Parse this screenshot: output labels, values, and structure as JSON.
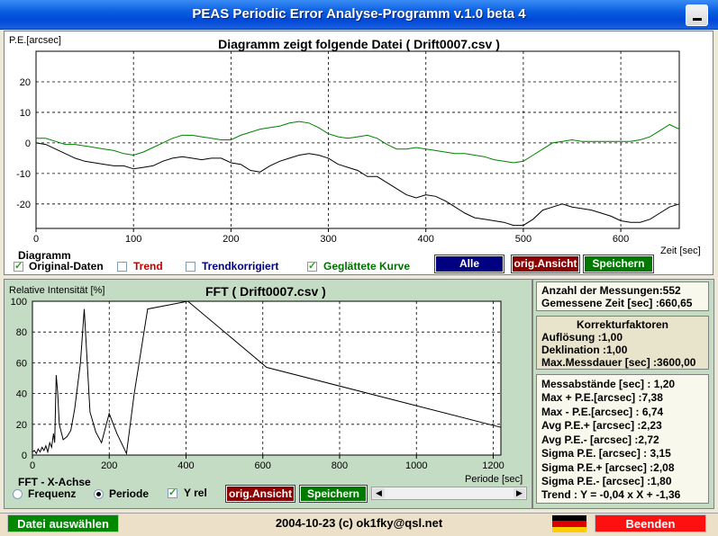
{
  "window": {
    "title": "PEAS Periodic Error Analyse-Programm v.1.0 beta 4"
  },
  "upper_chart": {
    "title": "Diagramm zeigt folgende Datei ( Drift0007.csv )",
    "ylabel": "P.E.[arcsec]",
    "xlabel": "Zeit [sec]",
    "y_ticks": [
      "20",
      "10",
      "0",
      "-10",
      "-20"
    ],
    "x_ticks": [
      "0",
      "100",
      "200",
      "300",
      "400",
      "500",
      "600"
    ]
  },
  "diagram_options": {
    "group_label": "Diagramm",
    "original": {
      "label": "Original-Daten",
      "checked": true
    },
    "trend": {
      "label": "Trend",
      "checked": false,
      "color": "#c00000"
    },
    "trendkorrigiert": {
      "label": "Trendkorrigiert",
      "checked": false,
      "color": "#000080"
    },
    "geglaettet": {
      "label": "Geglättete Kurve",
      "checked": true,
      "color": "#007000"
    },
    "alle_label": "Alle",
    "orig_label": "orig.Ansicht",
    "save_label": "Speichern"
  },
  "fft_chart": {
    "title": "FFT ( Drift0007.csv )",
    "ylabel": "Relative Intensität [%]",
    "xlabel": "Periode [sec]",
    "y_ticks": [
      "100",
      "80",
      "60",
      "40",
      "20",
      "0"
    ],
    "x_ticks": [
      "0",
      "200",
      "400",
      "600",
      "800",
      "1000",
      "1200"
    ]
  },
  "fft_controls": {
    "axis_label": "FFT - X-Achse",
    "frequenz": "Frequenz",
    "periode": "Periode",
    "selected": "Periode",
    "yrel_label": "Y rel",
    "yrel_checked": true,
    "orig_label": "orig.Ansicht",
    "save_label": "Speichern"
  },
  "measurement": {
    "anzahl": "Anzahl der Messungen:552",
    "zeit": "Gemessene Zeit [sec] :660,65"
  },
  "korrektur": {
    "heading": "Korrekturfaktoren",
    "aufloesung": "Auflösung :1,00",
    "deklination": "Deklination :1,00",
    "messdauer": "Max.Messdauer [sec] :3600,00"
  },
  "stats": [
    "Messabstände [sec] : 1,20",
    "Max + P.E.[arcsec] :7,38",
    "Max - P.E.[arcsec] : 6,74",
    "Avg P.E.+ [arcsec] :2,23",
    "Avg P.E.- [arcsec] :2,72",
    "Sigma P.E. [arcsec] : 3,15",
    "Sigma P.E.+ [arcsec] :2,08",
    "Sigma P.E.- [arcsec] :1,80",
    "Trend : Y = -0,04 x X + -1,36"
  ],
  "statusbar": {
    "file_button": "Datei auswählen",
    "info": "2004-10-23 (c) ok1fky@qsl.net",
    "exit_button": "Beenden",
    "flag_icon": "german-flag-icon"
  },
  "chart_data": [
    {
      "type": "line",
      "title": "Diagramm zeigt folgende Datei ( Drift0007.csv )",
      "xlabel": "Zeit [sec]",
      "ylabel": "P.E.[arcsec]",
      "xlim": [
        0,
        660
      ],
      "ylim": [
        -28,
        30
      ],
      "grid": true,
      "series": [
        {
          "name": "Original-Daten",
          "color": "#000000",
          "x": [
            0,
            10,
            20,
            30,
            40,
            50,
            60,
            70,
            80,
            90,
            100,
            110,
            120,
            130,
            140,
            150,
            160,
            170,
            180,
            190,
            200,
            210,
            220,
            230,
            240,
            250,
            260,
            270,
            280,
            290,
            300,
            310,
            320,
            330,
            340,
            350,
            360,
            370,
            380,
            390,
            400,
            410,
            420,
            430,
            440,
            450,
            460,
            470,
            480,
            490,
            500,
            510,
            520,
            530,
            540,
            550,
            560,
            570,
            580,
            590,
            600,
            610,
            620,
            630,
            640,
            650,
            660
          ],
          "values": [
            0,
            -0.5,
            -2,
            -3.5,
            -5,
            -6,
            -6.5,
            -7,
            -7.5,
            -7.5,
            -8.5,
            -8,
            -7.5,
            -6,
            -5,
            -4.5,
            -5,
            -5.5,
            -5,
            -5,
            -6.5,
            -7,
            -9,
            -9.5,
            -7.5,
            -6,
            -5,
            -4,
            -3.5,
            -4,
            -5,
            -7,
            -8,
            -9,
            -11,
            -11,
            -13,
            -15,
            -17,
            -18,
            -17,
            -17.5,
            -19,
            -21,
            -23,
            -24.5,
            -25,
            -25.5,
            -26,
            -27,
            -27,
            -25,
            -22,
            -21,
            -20,
            -21,
            -21.5,
            -22,
            -23,
            -24,
            -25.5,
            -26,
            -26,
            -25,
            -23,
            -21,
            -20
          ]
        },
        {
          "name": "Geglättete Kurve",
          "color": "#008000",
          "x": [
            0,
            10,
            20,
            30,
            40,
            50,
            60,
            70,
            80,
            90,
            100,
            110,
            120,
            130,
            140,
            150,
            160,
            170,
            180,
            190,
            200,
            210,
            220,
            230,
            240,
            250,
            260,
            270,
            280,
            290,
            300,
            310,
            320,
            330,
            340,
            350,
            360,
            370,
            380,
            390,
            400,
            410,
            420,
            430,
            440,
            450,
            460,
            470,
            480,
            490,
            500,
            510,
            520,
            530,
            540,
            550,
            560,
            570,
            580,
            590,
            600,
            610,
            620,
            630,
            640,
            650,
            660
          ],
          "values": [
            1.5,
            1.5,
            0.5,
            -0.5,
            -0.5,
            -1,
            -1.5,
            -2,
            -2.5,
            -3.5,
            -4,
            -3,
            -1.5,
            0,
            1.5,
            2.5,
            2.5,
            2,
            1.5,
            1,
            1,
            2.5,
            3.5,
            4.5,
            5,
            5.5,
            6.5,
            7,
            6.5,
            5,
            3,
            2,
            1.5,
            2,
            2.5,
            1.5,
            -0.5,
            -2,
            -2,
            -1.5,
            -2,
            -2.5,
            -3,
            -3.5,
            -3.5,
            -4,
            -4.5,
            -5.5,
            -6,
            -6.5,
            -6,
            -4,
            -2,
            0,
            0.5,
            1,
            0.5,
            0.5,
            0.5,
            0.5,
            0.5,
            0.5,
            1,
            2,
            4,
            6,
            4.5
          ]
        }
      ]
    },
    {
      "type": "line",
      "title": "FFT ( Drift0007.csv )",
      "xlabel": "Periode [sec]",
      "ylabel": "Relative Intensität [%]",
      "xlim": [
        0,
        1220
      ],
      "ylim": [
        0,
        100
      ],
      "grid": true,
      "series": [
        {
          "color": "#000000",
          "x": [
            0,
            5,
            10,
            15,
            20,
            25,
            30,
            35,
            40,
            45,
            50,
            55,
            58,
            62,
            66,
            70,
            80,
            90,
            100,
            110,
            125,
            135,
            150,
            165,
            180,
            200,
            220,
            245,
            265,
            300,
            405,
            610,
            1220
          ],
          "values": [
            2,
            3,
            1,
            4,
            2,
            5,
            3,
            6,
            2,
            8,
            5,
            14,
            8,
            52,
            40,
            20,
            10,
            12,
            16,
            30,
            60,
            95,
            28,
            15,
            8,
            27,
            14,
            1,
            40,
            95,
            100,
            57,
            18
          ]
        }
      ]
    }
  ]
}
